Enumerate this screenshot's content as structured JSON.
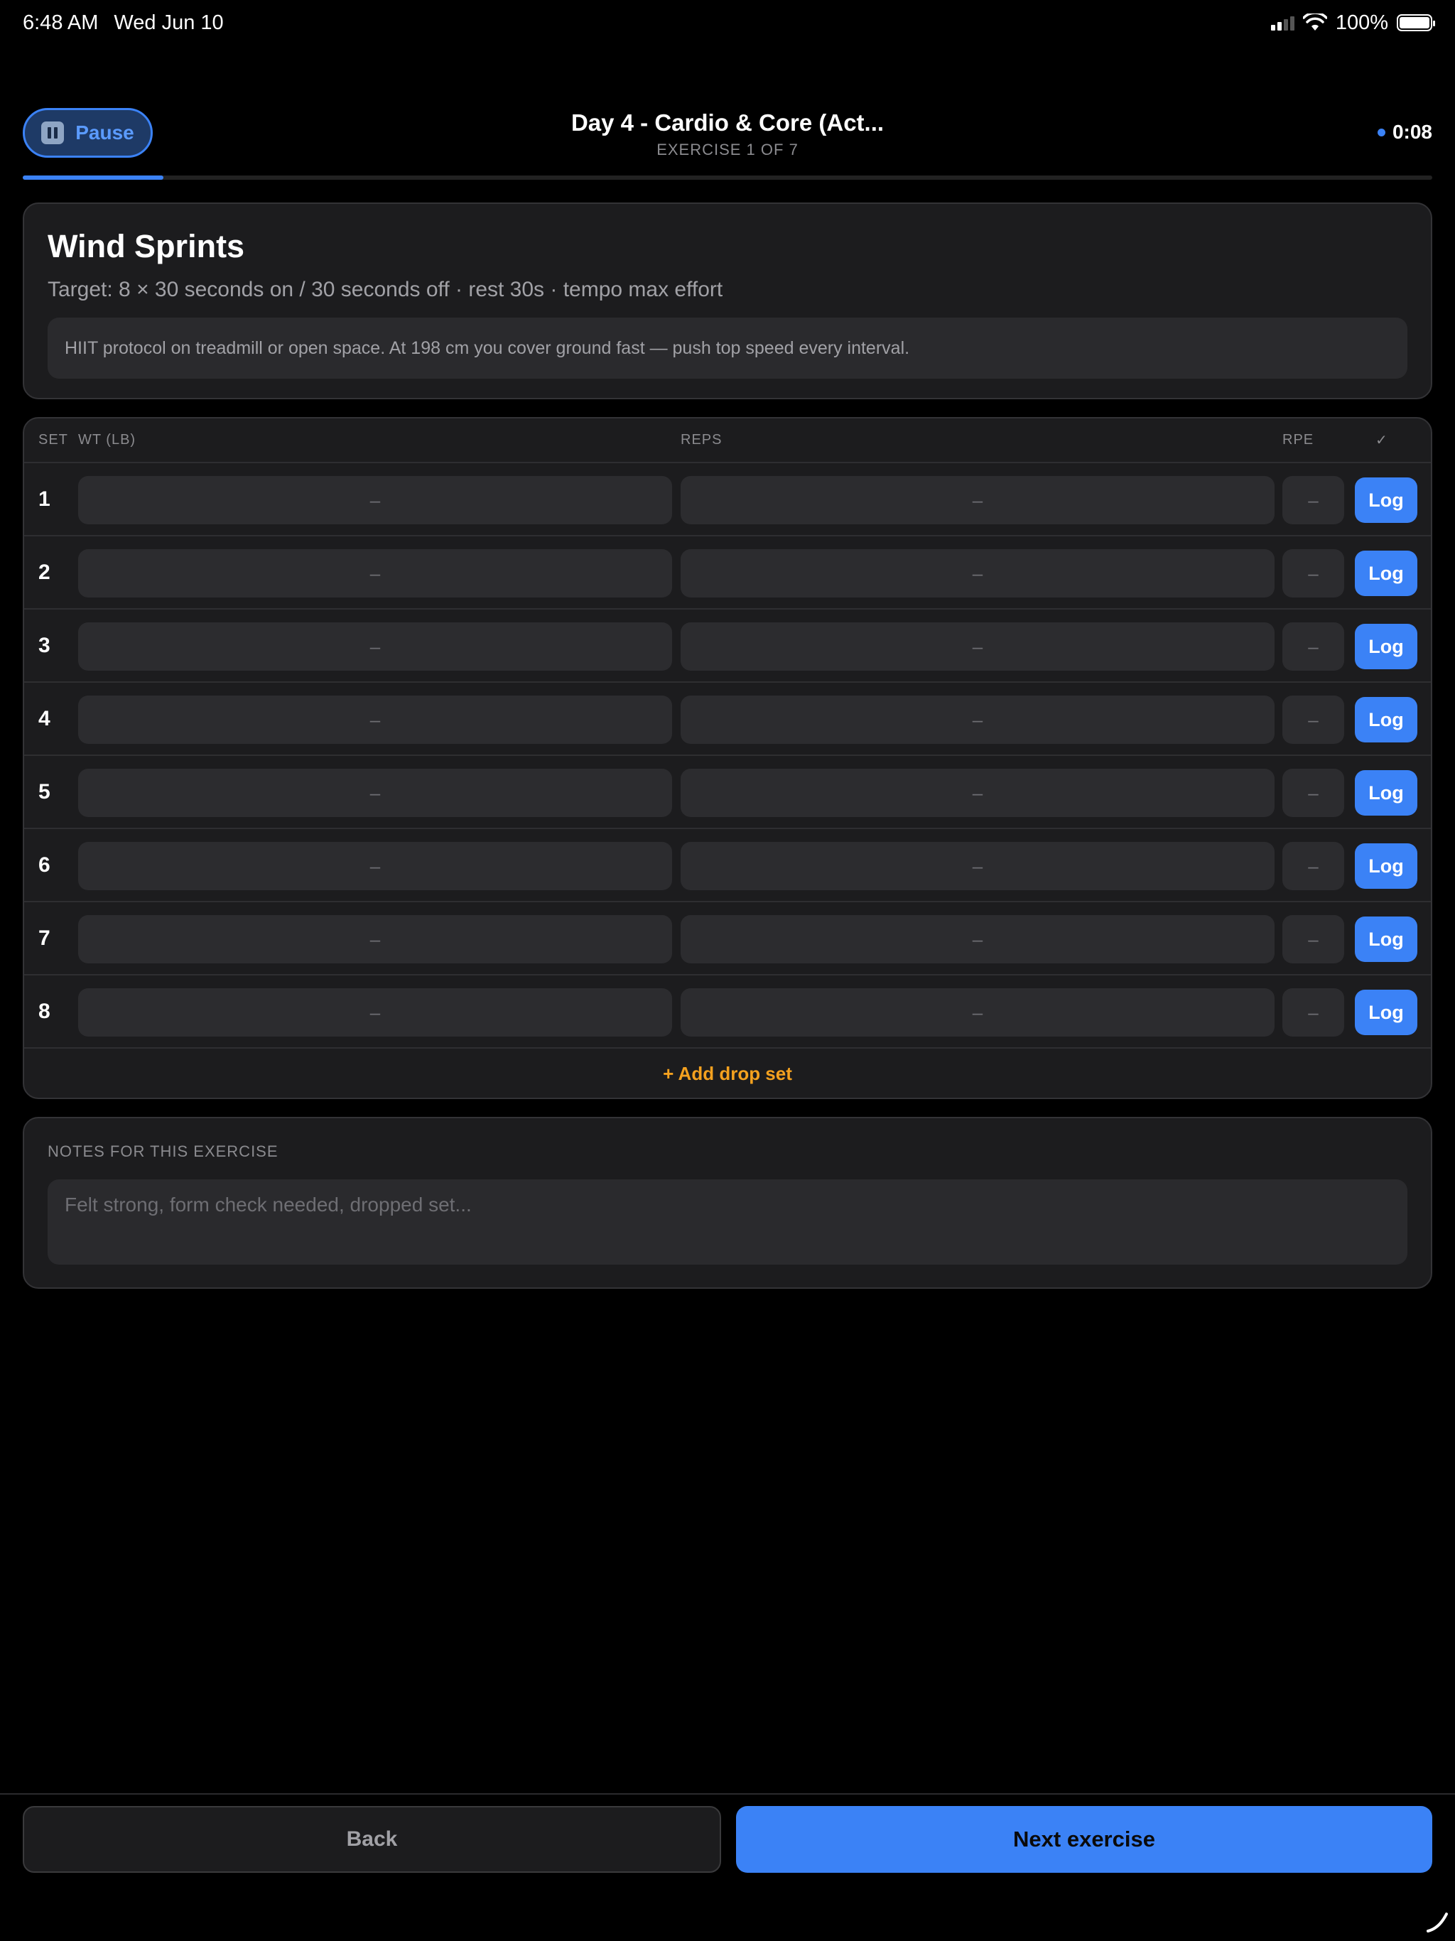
{
  "status_bar": {
    "time": "6:48 AM",
    "date": "Wed Jun 10",
    "battery": "100%"
  },
  "header": {
    "pause_label": "Pause",
    "title": "Day 4 - Cardio & Core (Act...",
    "subtitle": "EXERCISE 1 OF 7",
    "timer": "0:08",
    "progress": 0.1
  },
  "exercise": {
    "name": "Wind Sprints",
    "target": "Target: 8 × 30 seconds on / 30 seconds off · rest 30s · tempo max effort",
    "description": "HIIT protocol on treadmill or open space. At 198 cm you cover ground fast — push top speed every interval."
  },
  "sets_table": {
    "headers": {
      "set": "SET",
      "weight": "WT (LB)",
      "reps": "REPS",
      "rpe": "RPE",
      "check": "✓"
    },
    "rows": [
      {
        "set": "1",
        "weight": "–",
        "reps": "–",
        "rpe": "–",
        "action": "Log"
      },
      {
        "set": "2",
        "weight": "–",
        "reps": "–",
        "rpe": "–",
        "action": "Log"
      },
      {
        "set": "3",
        "weight": "–",
        "reps": "–",
        "rpe": "–",
        "action": "Log"
      },
      {
        "set": "4",
        "weight": "–",
        "reps": "–",
        "rpe": "–",
        "action": "Log"
      },
      {
        "set": "5",
        "weight": "–",
        "reps": "–",
        "rpe": "–",
        "action": "Log"
      },
      {
        "set": "6",
        "weight": "–",
        "reps": "–",
        "rpe": "–",
        "action": "Log"
      },
      {
        "set": "7",
        "weight": "–",
        "reps": "–",
        "rpe": "–",
        "action": "Log"
      },
      {
        "set": "8",
        "weight": "–",
        "reps": "–",
        "rpe": "–",
        "action": "Log"
      }
    ],
    "add_drop_set": "+ Add drop set"
  },
  "notes": {
    "label": "NOTES FOR THIS EXERCISE",
    "placeholder": "Felt strong, form check needed, dropped set...",
    "value": ""
  },
  "footer": {
    "back_label": "Back",
    "next_label": "Next exercise"
  },
  "colors": {
    "accent": "#3b82f6",
    "warning": "#f4a11f",
    "card_bg": "#1c1c1e"
  }
}
